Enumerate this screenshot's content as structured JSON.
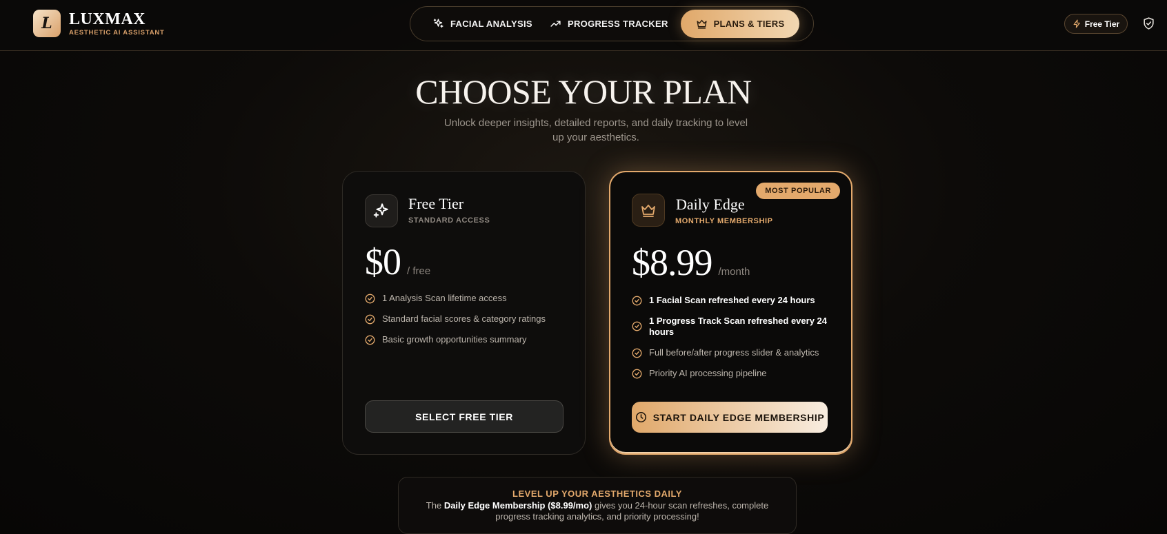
{
  "brand": {
    "logo_letter": "L",
    "name": "LUXMAX",
    "subtitle": "AESTHETIC AI ASSISTANT"
  },
  "nav": {
    "items": [
      {
        "label": "FACIAL ANALYSIS",
        "icon": "sparkle-icon",
        "active": false
      },
      {
        "label": "PROGRESS TRACKER",
        "icon": "trending-up-icon",
        "active": false
      },
      {
        "label": "PLANS & TIERS",
        "icon": "crown-icon",
        "active": true
      }
    ]
  },
  "account": {
    "tier_label": "Free Tier",
    "tier_icon": "lightning-icon",
    "shield_icon": "shield-check-icon"
  },
  "hero": {
    "title": "CHOOSE YOUR PLAN",
    "subtitle": "Unlock deeper insights, detailed reports, and daily tracking to level up your aesthetics."
  },
  "plans": {
    "free": {
      "name": "Free Tier",
      "tag": "STANDARD ACCESS",
      "icon": "sparkles-icon",
      "price": "$0",
      "unit": "/ free",
      "features": [
        "1 Analysis Scan lifetime access",
        "Standard facial scores & category ratings",
        "Basic growth opportunities summary"
      ],
      "button": "SELECT FREE TIER"
    },
    "edge": {
      "badge": "MOST POPULAR",
      "name": "Daily Edge",
      "tag": "MONTHLY MEMBERSHIP",
      "icon": "crown-icon",
      "price": "$8.99",
      "unit": "/month",
      "features": [
        "1 Facial Scan refreshed every 24 hours",
        "1 Progress Track Scan refreshed every 24 hours",
        "Full before/after progress slider & analytics",
        "Priority AI processing pipeline"
      ],
      "button": "START DAILY EDGE MEMBERSHIP",
      "button_icon": "clock-icon"
    }
  },
  "banner": {
    "title": "LEVEL UP YOUR AESTHETICS DAILY",
    "body_prefix": "The ",
    "body_bold": "Daily Edge Membership ($8.99/mo)",
    "body_suffix": " gives you 24-hour scan refreshes, complete progress tracking analytics, and priority processing!"
  },
  "colors": {
    "accent": "#e3a96c",
    "accent_light": "#f2d7b2",
    "background": "#0d0b09"
  }
}
